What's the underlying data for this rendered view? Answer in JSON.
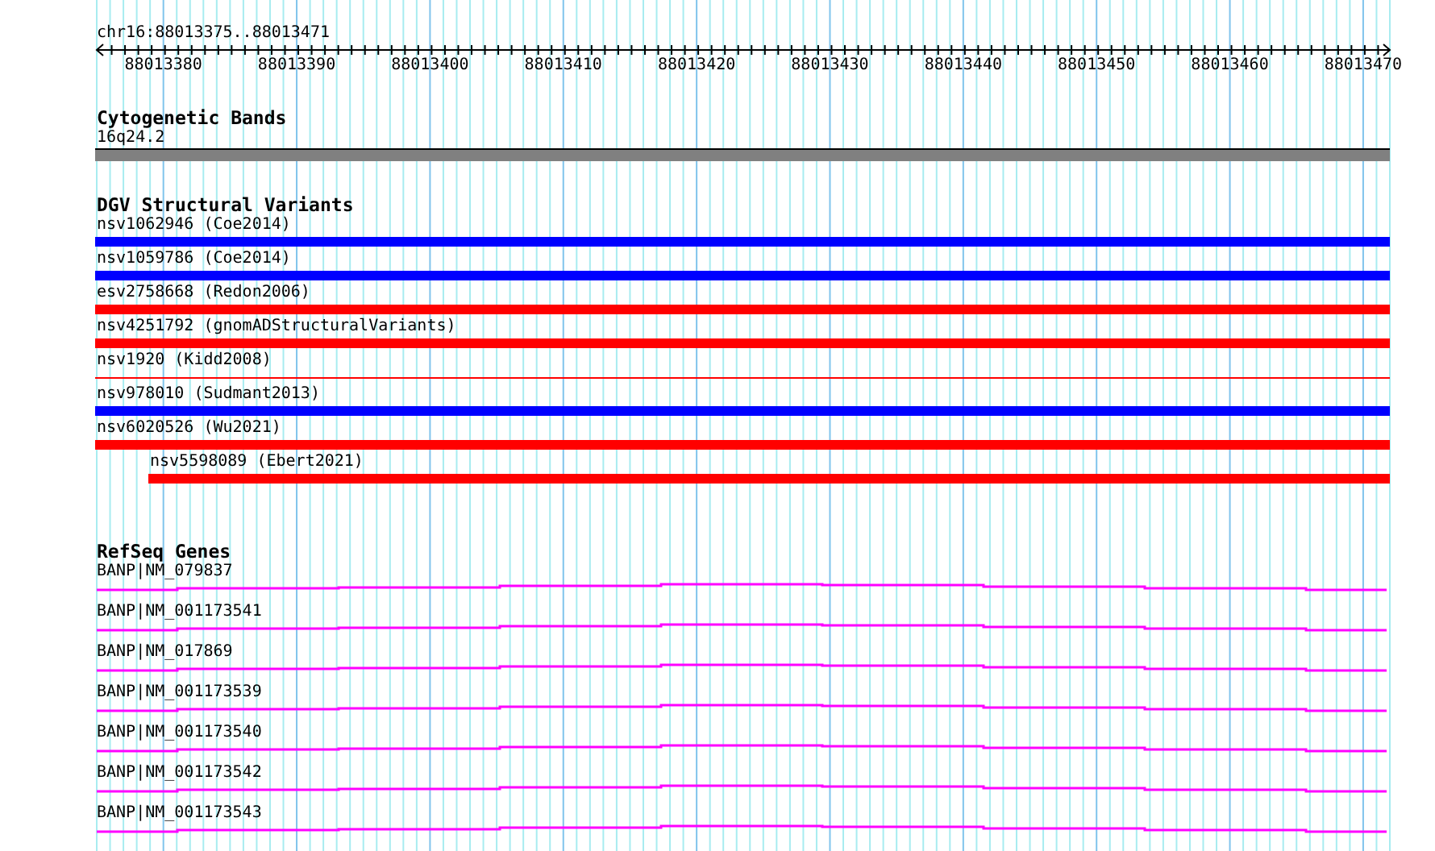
{
  "location": "chr16:88013375..88013471",
  "ruler": {
    "labels": [
      "88013380",
      "88013390",
      "88013400",
      "88013410",
      "88013420",
      "88013430",
      "88013440",
      "88013450",
      "88013460",
      "88013470"
    ]
  },
  "cytogenetic_bands": {
    "title": "Cytogenetic Bands",
    "features": [
      {
        "label": "16q24.2"
      }
    ]
  },
  "dgv_structural_variants": {
    "title": "DGV Structural Variants",
    "features": [
      {
        "label": "nsv1062946 (Coe2014)",
        "color": "#0000ff",
        "thin": false,
        "starts_in_view": false
      },
      {
        "label": "nsv1059786 (Coe2014)",
        "color": "#0000ff",
        "thin": false,
        "starts_in_view": false
      },
      {
        "label": "esv2758668 (Redon2006)",
        "color": "#ff0000",
        "thin": false,
        "starts_in_view": false
      },
      {
        "label": "nsv4251792 (gnomADStructuralVariants)",
        "color": "#ff0000",
        "thin": false,
        "starts_in_view": false
      },
      {
        "label": "nsv1920 (Kidd2008)",
        "color": "#ff0000",
        "thin": true,
        "starts_in_view": false
      },
      {
        "label": "nsv978010 (Sudmant2013)",
        "color": "#0000ff",
        "thin": false,
        "starts_in_view": false
      },
      {
        "label": "nsv6020526 (Wu2021)",
        "color": "#ff0000",
        "thin": false,
        "starts_in_view": false
      },
      {
        "label": "nsv5598089 (Ebert2021)",
        "color": "#ff0000",
        "thin": false,
        "starts_in_view": true
      }
    ]
  },
  "refseq_genes": {
    "title": "RefSeq Genes",
    "features": [
      {
        "label": "BANP|NM_079837"
      },
      {
        "label": "BANP|NM_001173541"
      },
      {
        "label": "BANP|NM_017869"
      },
      {
        "label": "BANP|NM_001173539"
      },
      {
        "label": "BANP|NM_001173540"
      },
      {
        "label": "BANP|NM_001173542"
      },
      {
        "label": "BANP|NM_001173543"
      }
    ]
  }
}
